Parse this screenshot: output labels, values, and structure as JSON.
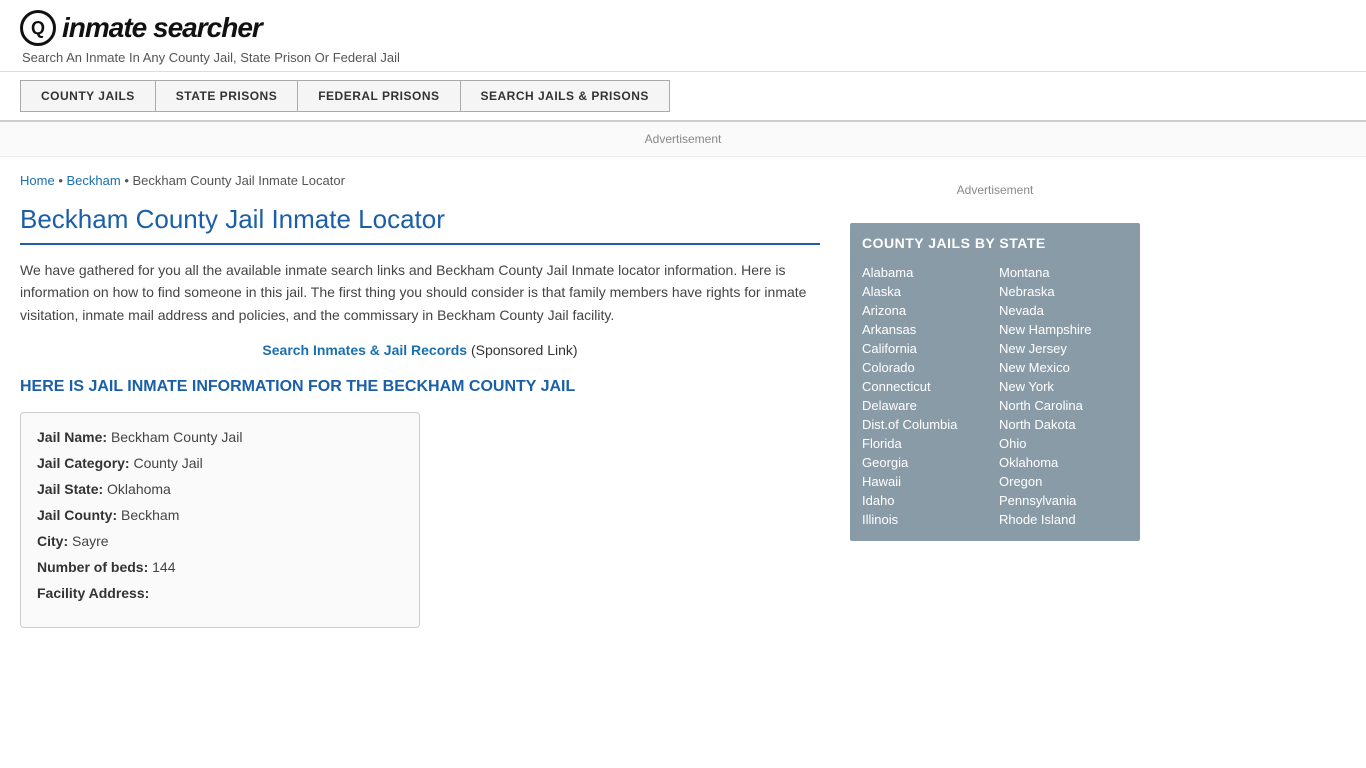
{
  "header": {
    "logo_icon": "🔍",
    "logo_text": "inmate searcher",
    "tagline": "Search An Inmate In Any County Jail, State Prison Or Federal Jail"
  },
  "nav": {
    "buttons": [
      {
        "label": "COUNTY JAILS",
        "id": "county-jails"
      },
      {
        "label": "STATE PRISONS",
        "id": "state-prisons"
      },
      {
        "label": "FEDERAL PRISONS",
        "id": "federal-prisons"
      },
      {
        "label": "SEARCH JAILS & PRISONS",
        "id": "search-jails"
      }
    ]
  },
  "ad_banner": "Advertisement",
  "breadcrumb": {
    "home": "Home",
    "parent": "Beckham",
    "current": "Beckham County Jail Inmate Locator"
  },
  "page_title": "Beckham County Jail Inmate Locator",
  "description": "We have gathered for you all the available inmate search links and Beckham County Jail Inmate locator information. Here is information on how to find someone in this jail. The first thing you should consider is that family members have rights for inmate visitation, inmate mail address and policies, and the commissary in Beckham County Jail facility.",
  "sponsored": {
    "link_text": "Search Inmates & Jail Records",
    "label": "(Sponsored Link)"
  },
  "info_heading": "HERE IS JAIL INMATE INFORMATION FOR THE BECKHAM COUNTY JAIL",
  "info_box": {
    "jail_name_label": "Jail Name:",
    "jail_name_value": "Beckham County Jail",
    "jail_category_label": "Jail Category:",
    "jail_category_value": "County Jail",
    "jail_state_label": "Jail State:",
    "jail_state_value": "Oklahoma",
    "jail_county_label": "Jail County:",
    "jail_county_value": "Beckham",
    "city_label": "City:",
    "city_value": "Sayre",
    "beds_label": "Number of beds:",
    "beds_value": "144",
    "address_label": "Facility Address:"
  },
  "sidebar": {
    "ad_label": "Advertisement",
    "state_box_title": "COUNTY JAILS BY STATE",
    "states_left": [
      "Alabama",
      "Alaska",
      "Arizona",
      "Arkansas",
      "California",
      "Colorado",
      "Connecticut",
      "Delaware",
      "Dist.of Columbia",
      "Florida",
      "Georgia",
      "Hawaii",
      "Idaho",
      "Illinois"
    ],
    "states_right": [
      "Montana",
      "Nebraska",
      "Nevada",
      "New Hampshire",
      "New Jersey",
      "New Mexico",
      "New York",
      "North Carolina",
      "North Dakota",
      "Ohio",
      "Oklahoma",
      "Oregon",
      "Pennsylvania",
      "Rhode Island"
    ]
  }
}
